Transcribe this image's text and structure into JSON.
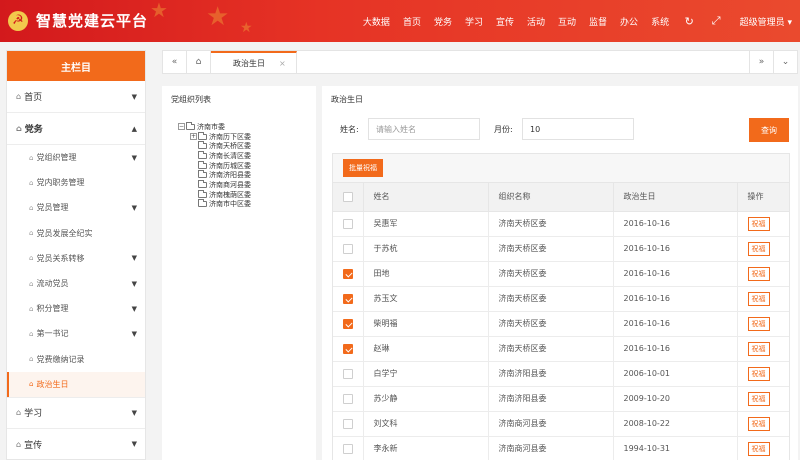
{
  "app": {
    "title": "智慧党建云平台"
  },
  "topnav": {
    "items": [
      "大数据",
      "首页",
      "党务",
      "学习",
      "宣传",
      "活动",
      "互动",
      "监督",
      "办公",
      "系统"
    ],
    "admin": "超级管理员 ▾"
  },
  "sidebar": {
    "title": "主栏目",
    "top": {
      "label": "首页"
    },
    "group": {
      "label": "党务"
    },
    "items": [
      {
        "label": "党组织管理",
        "caret": true
      },
      {
        "label": "党内职务管理",
        "caret": false
      },
      {
        "label": "党员管理",
        "caret": true
      },
      {
        "label": "党员发展全纪实",
        "caret": false
      },
      {
        "label": "党员关系转移",
        "caret": true
      },
      {
        "label": "流动党员",
        "caret": true
      },
      {
        "label": "积分管理",
        "caret": true
      },
      {
        "label": "第一书记",
        "caret": true
      },
      {
        "label": "党费缴纳记录",
        "caret": false
      },
      {
        "label": "政治生日",
        "caret": false,
        "active": true
      }
    ],
    "bottom": [
      {
        "label": "学习"
      },
      {
        "label": "宣传"
      }
    ]
  },
  "tabs": [
    {
      "label": "政治生日"
    }
  ],
  "org_panel": {
    "title": "党组织列表",
    "root": "济南市委",
    "children": [
      "济南历下区委",
      "济南天桥区委",
      "济南长清区委",
      "济南历城区委",
      "济南济阳县委",
      "济南商河县委",
      "济南槐荫区委",
      "济南市中区委"
    ]
  },
  "main": {
    "title": "政治生日",
    "name_label": "姓名:",
    "name_placeholder": "请输入姓名",
    "month_label": "月份:",
    "month_value": "10",
    "query_label": "查询",
    "batch_label": "批量祝福",
    "columns": [
      "姓名",
      "组织名称",
      "政治生日",
      "操作"
    ],
    "rows": [
      {
        "name": "吴惠军",
        "org": "济南天桥区委",
        "date": "2016-10-16",
        "checked": false,
        "action": "祝福"
      },
      {
        "name": "于苏杭",
        "org": "济南天桥区委",
        "date": "2016-10-16",
        "checked": false,
        "action": "祝福"
      },
      {
        "name": "田地",
        "org": "济南天桥区委",
        "date": "2016-10-16",
        "checked": true,
        "action": "祝福"
      },
      {
        "name": "苏玉文",
        "org": "济南天桥区委",
        "date": "2016-10-16",
        "checked": true,
        "action": "祝福"
      },
      {
        "name": "柴明福",
        "org": "济南天桥区委",
        "date": "2016-10-16",
        "checked": true,
        "action": "祝福"
      },
      {
        "name": "赵琳",
        "org": "济南天桥区委",
        "date": "2016-10-16",
        "checked": true,
        "action": "祝福"
      },
      {
        "name": "白学宁",
        "org": "济南济阳县委",
        "date": "2006-10-01",
        "checked": false,
        "action": "祝福"
      },
      {
        "name": "苏少静",
        "org": "济南济阳县委",
        "date": "2009-10-20",
        "checked": false,
        "action": "祝福"
      },
      {
        "name": "刘文科",
        "org": "济南商河县委",
        "date": "2008-10-22",
        "checked": false,
        "action": "祝福"
      },
      {
        "name": "李永新",
        "org": "济南商河县委",
        "date": "1994-10-31",
        "checked": false,
        "action": "祝福"
      }
    ]
  },
  "colors": {
    "header_red": "#d3191c",
    "accent_orange": "#f26a1b"
  },
  "icons": [
    "party-emblem-icon",
    "refresh-icon",
    "fullscreen-icon",
    "home-icon",
    "double-left-icon",
    "double-right-icon",
    "chevron-down-icon",
    "folder-icon"
  ]
}
